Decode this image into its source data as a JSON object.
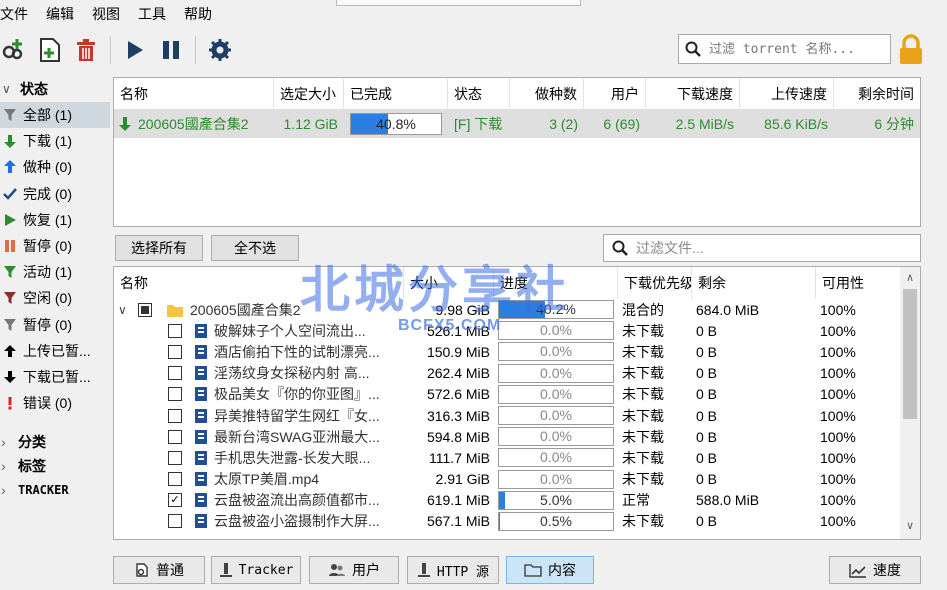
{
  "menu": [
    "文件",
    "编辑",
    "视图",
    "工具",
    "帮助"
  ],
  "toolbar": {
    "search_placeholder": "过滤 torrent 名称...",
    "icons": [
      "add-link-icon",
      "add-file-icon",
      "delete-icon",
      "play-icon",
      "pause-icon",
      "settings-icon"
    ],
    "lock_color": "#e8a317"
  },
  "sidebar": {
    "status_title": "状态",
    "items": [
      {
        "label": "全部 (1)",
        "icon": "filter-funnel-icon",
        "color": "#777777"
      },
      {
        "label": "下载 (1)",
        "icon": "arrow-down-icon",
        "color": "#2e8b2e"
      },
      {
        "label": "做种 (0)",
        "icon": "arrow-up-icon",
        "color": "#1e6fe0"
      },
      {
        "label": "完成 (0)",
        "icon": "check-icon",
        "color": "#1c4f8a"
      },
      {
        "label": "恢复 (1)",
        "icon": "play-icon",
        "color": "#2e8b2e"
      },
      {
        "label": "暂停 (0)",
        "icon": "pause-icon",
        "color": "#e06a4a"
      },
      {
        "label": "活动 (1)",
        "icon": "filter-funnel-icon",
        "color": "#2e8b2e"
      },
      {
        "label": "空闲 (0)",
        "icon": "filter-funnel-icon",
        "color": "#8b2e2e"
      },
      {
        "label": "暂停 (0)",
        "icon": "filter-funnel-icon",
        "color": "#777777"
      },
      {
        "label": "上传已暂...",
        "icon": "arrow-up-bold-icon",
        "color": "#000000"
      },
      {
        "label": "下载已暂...",
        "icon": "arrow-down-bold-icon",
        "color": "#000000"
      },
      {
        "label": "错误 (0)",
        "icon": "exclamation-icon",
        "color": "#e02020"
      }
    ],
    "category_title": "分类",
    "tags_title": "标签",
    "tracker_title": "TRACKER"
  },
  "torrents": {
    "columns": [
      "名称",
      "选定大小",
      "已完成",
      "状态",
      "做种数",
      "用户",
      "下载速度",
      "上传速度",
      "剩余时间"
    ],
    "rows": [
      {
        "name": "200605國產合集2",
        "size": "1.12 GiB",
        "progress_text": "40.8%",
        "progress": 0.408,
        "status": "[F] 下载",
        "seeds": "3 (2)",
        "peers": "6 (69)",
        "down": "2.5 MiB/s",
        "up": "85.6 KiB/s",
        "eta": "6 分钟"
      }
    ]
  },
  "buttons": {
    "select_all": "选择所有",
    "select_none": "全不选"
  },
  "file_filter_placeholder": "过滤文件...",
  "content": {
    "columns": [
      "名称",
      "大小",
      "进度",
      "下载优先级",
      "剩余",
      "可用性"
    ],
    "root": {
      "name": "200605國產合集2",
      "size": "9.98 GiB",
      "progress_text": "40.2%",
      "progress": 0.402,
      "priority": "混合的",
      "remaining": "684.0 MiB",
      "availability": "100%"
    },
    "files": [
      {
        "name": "破解妹子个人空间流出...",
        "size": "526.1 MiB",
        "progress_text": "0.0%",
        "progress": 0.0,
        "priority": "未下载",
        "remaining": "0 B",
        "availability": "100%",
        "checked": false
      },
      {
        "name": "酒店偷拍下性的试制漂亮...",
        "size": "150.9 MiB",
        "progress_text": "0.0%",
        "progress": 0.0,
        "priority": "未下载",
        "remaining": "0 B",
        "availability": "100%",
        "checked": false
      },
      {
        "name": "淫荡纹身女探秘内射 高...",
        "size": "262.4 MiB",
        "progress_text": "0.0%",
        "progress": 0.0,
        "priority": "未下载",
        "remaining": "0 B",
        "availability": "100%",
        "checked": false
      },
      {
        "name": "极品美女『你的你亚图』...",
        "size": "572.6 MiB",
        "progress_text": "0.0%",
        "progress": 0.0,
        "priority": "未下载",
        "remaining": "0 B",
        "availability": "100%",
        "checked": false
      },
      {
        "name": "异美推特留学生网红『女...",
        "size": "316.3 MiB",
        "progress_text": "0.0%",
        "progress": 0.0,
        "priority": "未下载",
        "remaining": "0 B",
        "availability": "100%",
        "checked": false
      },
      {
        "name": "最新台湾SWAG亚洲最大...",
        "size": "594.8 MiB",
        "progress_text": "0.0%",
        "progress": 0.0,
        "priority": "未下载",
        "remaining": "0 B",
        "availability": "100%",
        "checked": false
      },
      {
        "name": "手机思失泄露-长发大眼...",
        "size": "111.7 MiB",
        "progress_text": "0.0%",
        "progress": 0.0,
        "priority": "未下载",
        "remaining": "0 B",
        "availability": "100%",
        "checked": false
      },
      {
        "name": "太原TP美眉.mp4",
        "size": "2.91 GiB",
        "progress_text": "0.0%",
        "progress": 0.0,
        "priority": "未下载",
        "remaining": "0 B",
        "availability": "100%",
        "checked": false
      },
      {
        "name": "云盘被盗流出高颜值都市...",
        "size": "619.1 MiB",
        "progress_text": "5.0%",
        "progress": 0.05,
        "priority": "正常",
        "remaining": "588.0 MiB",
        "availability": "100%",
        "checked": true
      },
      {
        "name": "云盘被盗小盗摄制作大屏...",
        "size": "567.1 MiB",
        "progress_text": "0.5%",
        "progress": 0.005,
        "priority": "未下载",
        "remaining": "0 B",
        "availability": "100%",
        "checked": false
      }
    ]
  },
  "watermark": {
    "main": "北城分享社",
    "sub": "BCFX5.COM"
  },
  "tabs": [
    {
      "label": "普通",
      "icon": "general-icon"
    },
    {
      "label": "Tracker",
      "icon": "tracker-icon"
    },
    {
      "label": "用户",
      "icon": "peers-icon"
    },
    {
      "label": "HTTP 源",
      "icon": "http-source-icon"
    },
    {
      "label": "内容",
      "icon": "folder-icon",
      "active": true
    },
    {
      "label": "速度",
      "icon": "speed-chart-icon"
    }
  ],
  "colors": {
    "accent": "#2a7fe0",
    "downloading": "#2e8b2e",
    "selected_row": "#dedede"
  }
}
